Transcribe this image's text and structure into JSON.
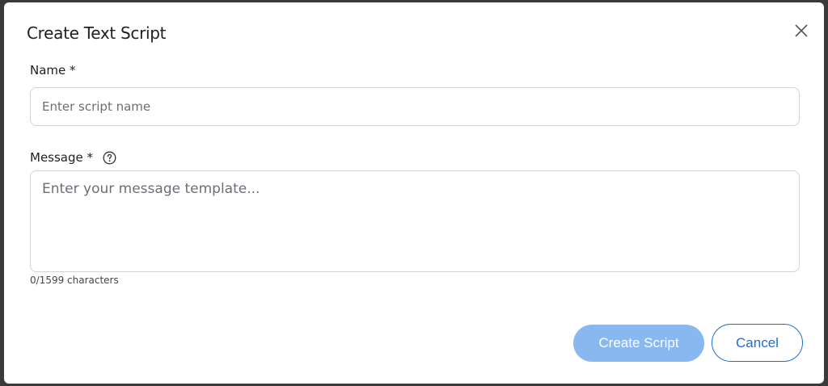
{
  "dialog": {
    "title": "Create Text Script",
    "name_label": "Name *",
    "name_placeholder": "Enter script name",
    "name_value": "",
    "message_label": "Message *",
    "message_placeholder": "Enter your message template...",
    "message_value": "",
    "char_count": "0/1599 characters",
    "create_label": "Create Script",
    "cancel_label": "Cancel"
  },
  "icons": {
    "close": "close-icon",
    "help": "help-icon"
  },
  "colors": {
    "primary": "#1a6fd6",
    "primary_disabled": "#89b7f0",
    "border": "#cfd4da"
  }
}
